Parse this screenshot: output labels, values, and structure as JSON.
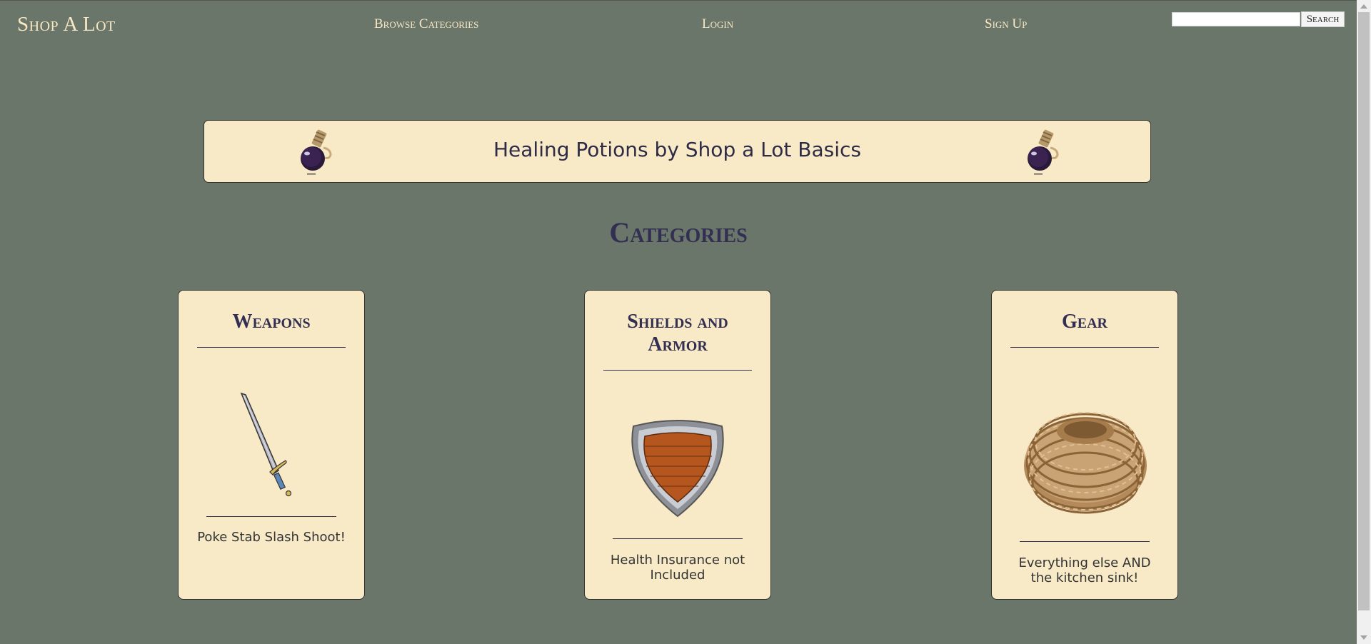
{
  "nav": {
    "brand": "Shop A Lot",
    "links": [
      "Browse Categories",
      "Login",
      "Sign Up"
    ],
    "search_placeholder": "",
    "search_button": "Search"
  },
  "banner": {
    "text": "Healing Potions by Shop a Lot Basics",
    "icon": "potion-icon"
  },
  "categories": {
    "title": "Categories",
    "items": [
      {
        "title": "Weapons",
        "description": "Poke Stab Slash Shoot!",
        "icon": "sword-icon"
      },
      {
        "title": "Shields and Armor",
        "description": "Health Insurance not Included",
        "icon": "shield-icon"
      },
      {
        "title": "Gear",
        "description": "Everything else AND the kitchen sink!",
        "icon": "rope-icon"
      }
    ]
  },
  "colors": {
    "background": "#6b766a",
    "card": "#f8e9c7",
    "heading": "#332f52",
    "nav_text": "#f7e7c2"
  }
}
